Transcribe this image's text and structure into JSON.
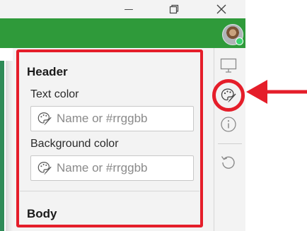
{
  "window": {
    "minimize_glyph": "—",
    "restore_glyph": "❐",
    "close_glyph": "✕"
  },
  "header": {
    "avatar_icon": "user-avatar",
    "status_color": "#3bd16f"
  },
  "panel": {
    "header_section": {
      "title": "Header",
      "text_color": {
        "label": "Text color",
        "placeholder": "Name or #rrggbb"
      },
      "background_color": {
        "label": "Background color",
        "placeholder": "Name or #rrggbb"
      }
    },
    "body_section": {
      "title": "Body"
    }
  },
  "rail": {
    "icons": [
      "monitor-icon",
      "palette-icon",
      "info-icon",
      "undo-icon"
    ]
  },
  "annotation": {
    "highlight_color": "#e51e2a",
    "accent_green": "#2f9a3a"
  }
}
